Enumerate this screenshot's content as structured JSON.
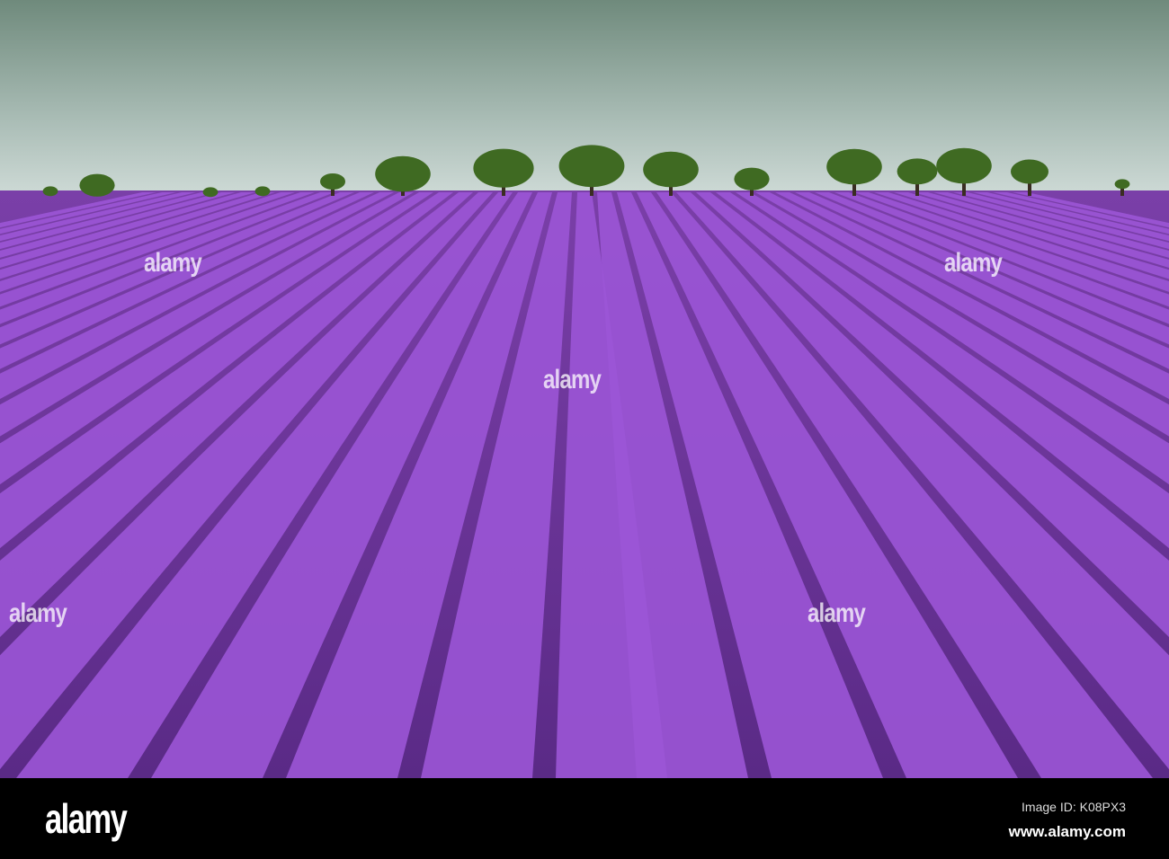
{
  "photo": {
    "subject": "lavender-field-with-trees",
    "colors": {
      "sky_top": "#6f8a7c",
      "sky_bottom": "#c9d6d2",
      "lavender": "#9b55d6",
      "lavender_dark": "#5e2a8a",
      "tree": "#3f6a22"
    }
  },
  "watermark": {
    "text": "alamy"
  },
  "footer": {
    "logo": "alamy",
    "image_id": "Image ID: K08PX3",
    "url": "www.alamy.com"
  }
}
